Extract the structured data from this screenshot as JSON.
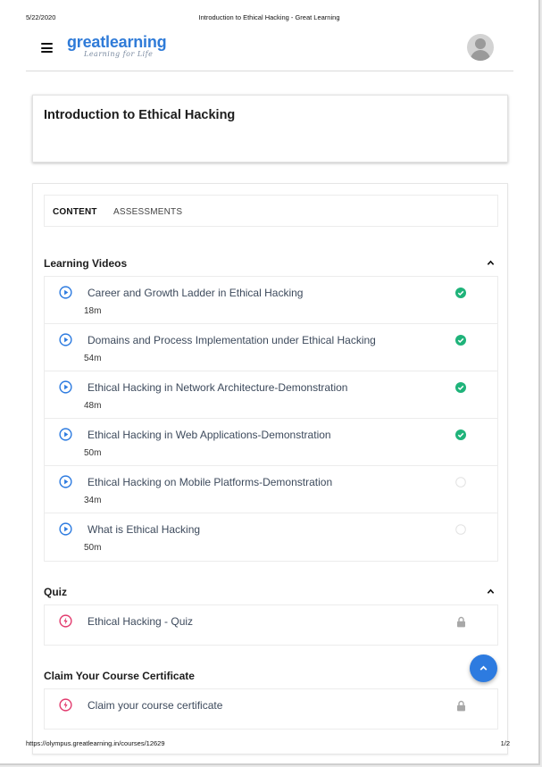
{
  "print_header": {
    "date": "5/22/2020",
    "title": "Introduction to Ethical Hacking - Great Learning"
  },
  "print_footer": {
    "url": "https://olympus.greatlearning.in/courses/12629",
    "page": "1/2"
  },
  "brand": {
    "name": "greatlearning",
    "tagline": "Learning for Life",
    "color": "#2f7bd8"
  },
  "course": {
    "title": "Introduction to Ethical Hacking"
  },
  "tabs": [
    {
      "label": "CONTENT",
      "active": true
    },
    {
      "label": "ASSESSMENTS",
      "active": false
    }
  ],
  "sections": {
    "videos": {
      "title": "Learning Videos",
      "items": [
        {
          "title": "Career and Growth Ladder in Ethical Hacking",
          "duration": "18m",
          "completed": true
        },
        {
          "title": "Domains and Process Implementation under Ethical Hacking",
          "duration": "54m",
          "completed": true
        },
        {
          "title": "Ethical Hacking in Network Architecture-Demonstration",
          "duration": "48m",
          "completed": true
        },
        {
          "title": "Ethical Hacking in Web Applications-Demonstration",
          "duration": "50m",
          "completed": true
        },
        {
          "title": "Ethical Hacking on Mobile Platforms-Demonstration",
          "duration": "34m",
          "completed": false
        },
        {
          "title": "What is Ethical Hacking",
          "duration": "50m",
          "completed": false
        }
      ]
    },
    "quiz": {
      "title": "Quiz",
      "items": [
        {
          "title": "Ethical Hacking - Quiz",
          "locked": true
        }
      ]
    },
    "certificate": {
      "title": "Claim Your Course Certificate",
      "items": [
        {
          "title": "Claim your course certificate",
          "locked": true
        }
      ]
    }
  },
  "colors": {
    "accent_blue": "#2d7be0",
    "complete_green": "#1fb37a",
    "quiz_pink": "#e23b6e",
    "lock_gray": "#a8a8a8"
  },
  "icons": {
    "menu": "hamburger-menu-icon",
    "avatar": "user-avatar-icon",
    "collapse": "chevron-up-icon",
    "video": "play-circle-icon",
    "done": "check-circle-icon",
    "pending": "empty-circle-icon",
    "quiz": "bolt-circle-icon",
    "locked": "lock-icon",
    "scroll_top": "arrow-up-icon"
  }
}
